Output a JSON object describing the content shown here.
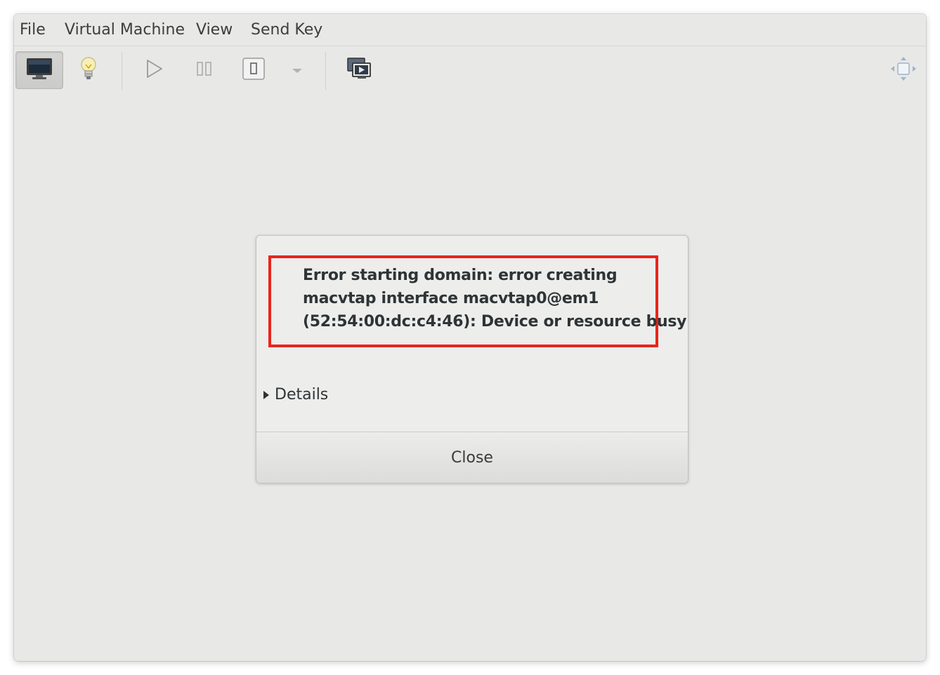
{
  "menubar": {
    "items": [
      "File",
      "Virtual Machine",
      "View",
      "Send Key"
    ]
  },
  "toolbar": {
    "buttons": [
      {
        "name": "console-view-button",
        "icon": "monitor-icon",
        "active": true
      },
      {
        "name": "details-view-button",
        "icon": "lightbulb-icon",
        "active": false
      },
      {
        "name": "run-button",
        "icon": "play-icon",
        "active": false
      },
      {
        "name": "pause-button",
        "icon": "pause-icon",
        "active": false
      },
      {
        "name": "shutdown-button",
        "icon": "power-icon",
        "active": false
      },
      {
        "name": "shutdown-menu-button",
        "icon": "chevron-down-icon",
        "active": false
      },
      {
        "name": "snapshots-button",
        "icon": "snapshot-icon",
        "active": false
      },
      {
        "name": "fullscreen-button",
        "icon": "fullscreen-icon",
        "active": false
      }
    ]
  },
  "dialog": {
    "message_lines": [
      "Error starting domain: error creating",
      "macvtap interface macvtap0@em1",
      "(52:54:00:dc:c4:46): Device or resource busy"
    ],
    "details_label": "Details",
    "close_label": "Close",
    "highlight_color": "#e8251c"
  }
}
